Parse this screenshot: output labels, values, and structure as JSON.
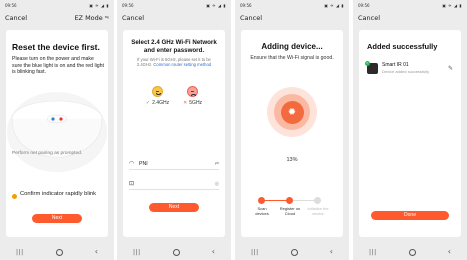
{
  "screens": [
    {
      "status": {
        "time": "09:56",
        "icons": "▣ ✈ ◢ ▮"
      },
      "topbar": {
        "cancel": "Cancel",
        "mode": "EZ Mode",
        "mode_icon": "swap-icon"
      },
      "title": "Reset the device first.",
      "description": "Please turn on the power and make sure the blue light is on and the red light is blinking fast.",
      "hint": "Perform net pairing as prompted.",
      "confirm_text": "Confirm indicator rapidly blink",
      "button": "Next"
    },
    {
      "status": {
        "time": "09:56",
        "icons": "▣ ✈ ◢ ▮"
      },
      "topbar": {
        "cancel": "Cancel"
      },
      "title": "Select 2.4 GHz Wi-Fi Network and enter password.",
      "note": "If your Wi-Fi is 5GHz, please set it to be 2.4GHz.",
      "note_link": "Common router setting method",
      "bands": [
        {
          "label": "2.4GHz",
          "status": "supported"
        },
        {
          "label": "5GHz",
          "status": "unsupported"
        }
      ],
      "wifi_name": "PNI",
      "wifi_action": "⇄",
      "password_value": "",
      "password_action": "◎",
      "button": "Next"
    },
    {
      "status": {
        "time": "09:56",
        "icons": "▣ ✈ ◢ ▮"
      },
      "topbar": {
        "cancel": "Cancel"
      },
      "title": "Adding device...",
      "subtitle": "Ensure that the Wi-Fi signal is good.",
      "progress_text": "13%",
      "progress": 0.13,
      "steps": [
        {
          "label": "Scan devices",
          "done": true
        },
        {
          "label": "Register on Cloud",
          "done": true
        },
        {
          "label": "Initialize the device",
          "done": false
        }
      ]
    },
    {
      "status": {
        "time": "09:56",
        "icons": "▣ ✈ ◢ ▮"
      },
      "topbar": {
        "cancel": "Cancel"
      },
      "title": "Added successfully",
      "device": {
        "name": "Smart IR 01",
        "subtitle": "Device added successfully"
      },
      "button": "Done"
    }
  ],
  "nav": {
    "recent": "|||",
    "back": "‹"
  },
  "colors": {
    "accent": "#ff5a2d",
    "success": "#36b25d",
    "warning": "#f0a000",
    "link": "#2f6bd8"
  }
}
